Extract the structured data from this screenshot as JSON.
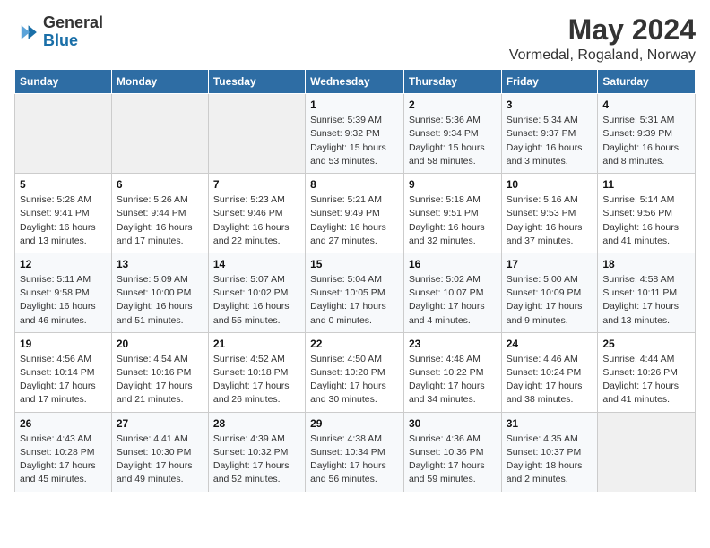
{
  "header": {
    "logo_general": "General",
    "logo_blue": "Blue",
    "title": "May 2024",
    "subtitle": "Vormedal, Rogaland, Norway"
  },
  "weekdays": [
    "Sunday",
    "Monday",
    "Tuesday",
    "Wednesday",
    "Thursday",
    "Friday",
    "Saturday"
  ],
  "weeks": [
    [
      {
        "day": "",
        "info": ""
      },
      {
        "day": "",
        "info": ""
      },
      {
        "day": "",
        "info": ""
      },
      {
        "day": "1",
        "info": "Sunrise: 5:39 AM\nSunset: 9:32 PM\nDaylight: 15 hours\nand 53 minutes."
      },
      {
        "day": "2",
        "info": "Sunrise: 5:36 AM\nSunset: 9:34 PM\nDaylight: 15 hours\nand 58 minutes."
      },
      {
        "day": "3",
        "info": "Sunrise: 5:34 AM\nSunset: 9:37 PM\nDaylight: 16 hours\nand 3 minutes."
      },
      {
        "day": "4",
        "info": "Sunrise: 5:31 AM\nSunset: 9:39 PM\nDaylight: 16 hours\nand 8 minutes."
      }
    ],
    [
      {
        "day": "5",
        "info": "Sunrise: 5:28 AM\nSunset: 9:41 PM\nDaylight: 16 hours\nand 13 minutes."
      },
      {
        "day": "6",
        "info": "Sunrise: 5:26 AM\nSunset: 9:44 PM\nDaylight: 16 hours\nand 17 minutes."
      },
      {
        "day": "7",
        "info": "Sunrise: 5:23 AM\nSunset: 9:46 PM\nDaylight: 16 hours\nand 22 minutes."
      },
      {
        "day": "8",
        "info": "Sunrise: 5:21 AM\nSunset: 9:49 PM\nDaylight: 16 hours\nand 27 minutes."
      },
      {
        "day": "9",
        "info": "Sunrise: 5:18 AM\nSunset: 9:51 PM\nDaylight: 16 hours\nand 32 minutes."
      },
      {
        "day": "10",
        "info": "Sunrise: 5:16 AM\nSunset: 9:53 PM\nDaylight: 16 hours\nand 37 minutes."
      },
      {
        "day": "11",
        "info": "Sunrise: 5:14 AM\nSunset: 9:56 PM\nDaylight: 16 hours\nand 41 minutes."
      }
    ],
    [
      {
        "day": "12",
        "info": "Sunrise: 5:11 AM\nSunset: 9:58 PM\nDaylight: 16 hours\nand 46 minutes."
      },
      {
        "day": "13",
        "info": "Sunrise: 5:09 AM\nSunset: 10:00 PM\nDaylight: 16 hours\nand 51 minutes."
      },
      {
        "day": "14",
        "info": "Sunrise: 5:07 AM\nSunset: 10:02 PM\nDaylight: 16 hours\nand 55 minutes."
      },
      {
        "day": "15",
        "info": "Sunrise: 5:04 AM\nSunset: 10:05 PM\nDaylight: 17 hours\nand 0 minutes."
      },
      {
        "day": "16",
        "info": "Sunrise: 5:02 AM\nSunset: 10:07 PM\nDaylight: 17 hours\nand 4 minutes."
      },
      {
        "day": "17",
        "info": "Sunrise: 5:00 AM\nSunset: 10:09 PM\nDaylight: 17 hours\nand 9 minutes."
      },
      {
        "day": "18",
        "info": "Sunrise: 4:58 AM\nSunset: 10:11 PM\nDaylight: 17 hours\nand 13 minutes."
      }
    ],
    [
      {
        "day": "19",
        "info": "Sunrise: 4:56 AM\nSunset: 10:14 PM\nDaylight: 17 hours\nand 17 minutes."
      },
      {
        "day": "20",
        "info": "Sunrise: 4:54 AM\nSunset: 10:16 PM\nDaylight: 17 hours\nand 21 minutes."
      },
      {
        "day": "21",
        "info": "Sunrise: 4:52 AM\nSunset: 10:18 PM\nDaylight: 17 hours\nand 26 minutes."
      },
      {
        "day": "22",
        "info": "Sunrise: 4:50 AM\nSunset: 10:20 PM\nDaylight: 17 hours\nand 30 minutes."
      },
      {
        "day": "23",
        "info": "Sunrise: 4:48 AM\nSunset: 10:22 PM\nDaylight: 17 hours\nand 34 minutes."
      },
      {
        "day": "24",
        "info": "Sunrise: 4:46 AM\nSunset: 10:24 PM\nDaylight: 17 hours\nand 38 minutes."
      },
      {
        "day": "25",
        "info": "Sunrise: 4:44 AM\nSunset: 10:26 PM\nDaylight: 17 hours\nand 41 minutes."
      }
    ],
    [
      {
        "day": "26",
        "info": "Sunrise: 4:43 AM\nSunset: 10:28 PM\nDaylight: 17 hours\nand 45 minutes."
      },
      {
        "day": "27",
        "info": "Sunrise: 4:41 AM\nSunset: 10:30 PM\nDaylight: 17 hours\nand 49 minutes."
      },
      {
        "day": "28",
        "info": "Sunrise: 4:39 AM\nSunset: 10:32 PM\nDaylight: 17 hours\nand 52 minutes."
      },
      {
        "day": "29",
        "info": "Sunrise: 4:38 AM\nSunset: 10:34 PM\nDaylight: 17 hours\nand 56 minutes."
      },
      {
        "day": "30",
        "info": "Sunrise: 4:36 AM\nSunset: 10:36 PM\nDaylight: 17 hours\nand 59 minutes."
      },
      {
        "day": "31",
        "info": "Sunrise: 4:35 AM\nSunset: 10:37 PM\nDaylight: 18 hours\nand 2 minutes."
      },
      {
        "day": "",
        "info": ""
      }
    ]
  ]
}
